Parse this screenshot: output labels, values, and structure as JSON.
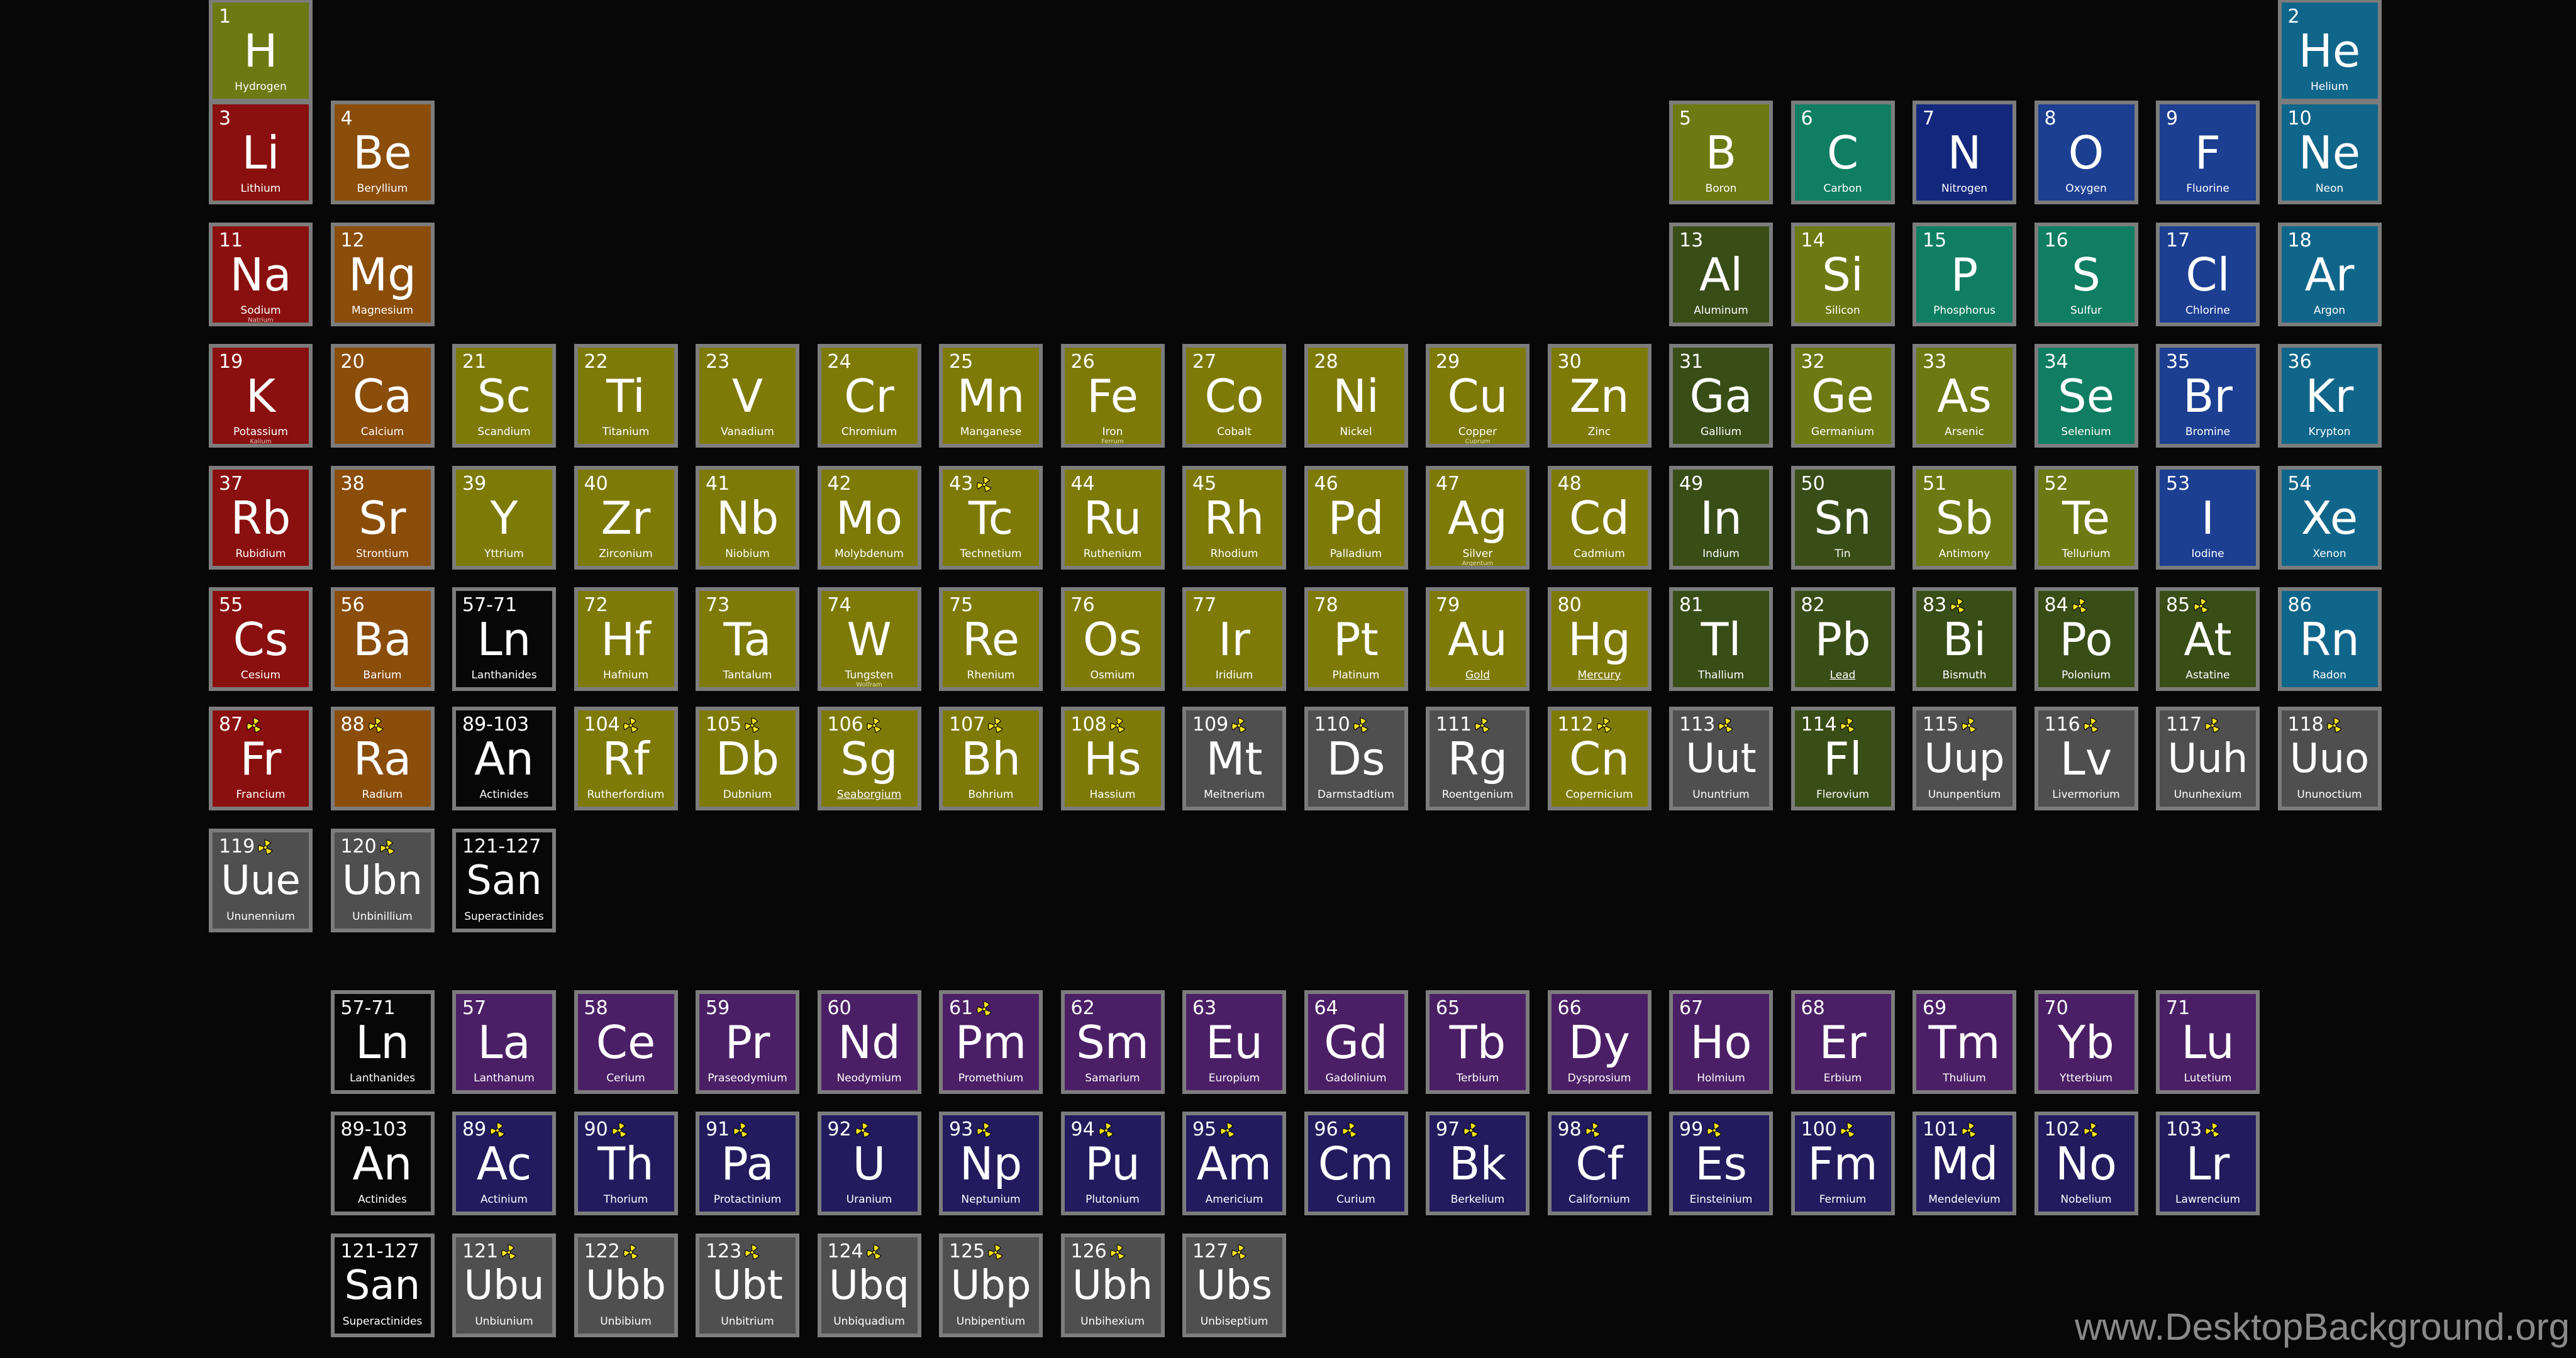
{
  "elements": [
    {
      "n": "1",
      "s": "H",
      "name": "Hydrogen",
      "c": "yg",
      "col": 1,
      "row": 1
    },
    {
      "n": "2",
      "s": "He",
      "name": "Helium",
      "c": "ng",
      "col": 18,
      "row": 1
    },
    {
      "n": "3",
      "s": "Li",
      "name": "Lithium",
      "c": "alk",
      "col": 1,
      "row": 2
    },
    {
      "n": "4",
      "s": "Be",
      "name": "Beryllium",
      "c": "ae",
      "col": 2,
      "row": 2
    },
    {
      "n": "5",
      "s": "B",
      "name": "Boron",
      "c": "yg",
      "col": 13,
      "row": 2
    },
    {
      "n": "6",
      "s": "C",
      "name": "Carbon",
      "c": "tl",
      "col": 14,
      "row": 2
    },
    {
      "n": "7",
      "s": "N",
      "name": "Nitrogen",
      "c": "nv",
      "col": 15,
      "row": 2
    },
    {
      "n": "8",
      "s": "O",
      "name": "Oxygen",
      "c": "bl",
      "col": 16,
      "row": 2
    },
    {
      "n": "9",
      "s": "F",
      "name": "Fluorine",
      "c": "bl",
      "col": 17,
      "row": 2
    },
    {
      "n": "10",
      "s": "Ne",
      "name": "Neon",
      "c": "ng",
      "col": 18,
      "row": 2
    },
    {
      "n": "11",
      "s": "Na",
      "name": "Sodium",
      "alt": "Natrium",
      "c": "alk",
      "col": 1,
      "row": 3
    },
    {
      "n": "12",
      "s": "Mg",
      "name": "Magnesium",
      "c": "ae",
      "col": 2,
      "row": 3
    },
    {
      "n": "13",
      "s": "Al",
      "name": "Aluminum",
      "c": "pt",
      "col": 13,
      "row": 3
    },
    {
      "n": "14",
      "s": "Si",
      "name": "Silicon",
      "c": "yg",
      "col": 14,
      "row": 3
    },
    {
      "n": "15",
      "s": "P",
      "name": "Phosphorus",
      "c": "tl",
      "col": 15,
      "row": 3
    },
    {
      "n": "16",
      "s": "S",
      "name": "Sulfur",
      "c": "tl",
      "col": 16,
      "row": 3
    },
    {
      "n": "17",
      "s": "Cl",
      "name": "Chlorine",
      "c": "bl",
      "col": 17,
      "row": 3
    },
    {
      "n": "18",
      "s": "Ar",
      "name": "Argon",
      "c": "ng",
      "col": 18,
      "row": 3
    },
    {
      "n": "19",
      "s": "K",
      "name": "Potassium",
      "alt": "Kalium",
      "c": "alk",
      "col": 1,
      "row": 4
    },
    {
      "n": "20",
      "s": "Ca",
      "name": "Calcium",
      "c": "ae",
      "col": 2,
      "row": 4
    },
    {
      "n": "21",
      "s": "Sc",
      "name": "Scandium",
      "c": "tm",
      "col": 3,
      "row": 4
    },
    {
      "n": "22",
      "s": "Ti",
      "name": "Titanium",
      "c": "tm",
      "col": 4,
      "row": 4
    },
    {
      "n": "23",
      "s": "V",
      "name": "Vanadium",
      "c": "tm",
      "col": 5,
      "row": 4
    },
    {
      "n": "24",
      "s": "Cr",
      "name": "Chromium",
      "c": "tm",
      "col": 6,
      "row": 4
    },
    {
      "n": "25",
      "s": "Mn",
      "name": "Manganese",
      "c": "tm",
      "col": 7,
      "row": 4
    },
    {
      "n": "26",
      "s": "Fe",
      "name": "Iron",
      "alt": "Ferrum",
      "c": "tm",
      "col": 8,
      "row": 4
    },
    {
      "n": "27",
      "s": "Co",
      "name": "Cobalt",
      "c": "tm",
      "col": 9,
      "row": 4
    },
    {
      "n": "28",
      "s": "Ni",
      "name": "Nickel",
      "c": "tm",
      "col": 10,
      "row": 4
    },
    {
      "n": "29",
      "s": "Cu",
      "name": "Copper",
      "alt": "Cuprum",
      "c": "tm",
      "col": 11,
      "row": 4
    },
    {
      "n": "30",
      "s": "Zn",
      "name": "Zinc",
      "c": "tm",
      "col": 12,
      "row": 4
    },
    {
      "n": "31",
      "s": "Ga",
      "name": "Gallium",
      "c": "pt",
      "col": 13,
      "row": 4
    },
    {
      "n": "32",
      "s": "Ge",
      "name": "Germanium",
      "c": "yg",
      "col": 14,
      "row": 4
    },
    {
      "n": "33",
      "s": "As",
      "name": "Arsenic",
      "c": "yg",
      "col": 15,
      "row": 4
    },
    {
      "n": "34",
      "s": "Se",
      "name": "Selenium",
      "c": "tl",
      "col": 16,
      "row": 4
    },
    {
      "n": "35",
      "s": "Br",
      "name": "Bromine",
      "c": "bl",
      "col": 17,
      "row": 4
    },
    {
      "n": "36",
      "s": "Kr",
      "name": "Krypton",
      "c": "ng",
      "col": 18,
      "row": 4
    },
    {
      "n": "37",
      "s": "Rb",
      "name": "Rubidium",
      "c": "alk",
      "col": 1,
      "row": 5
    },
    {
      "n": "38",
      "s": "Sr",
      "name": "Strontium",
      "c": "ae",
      "col": 2,
      "row": 5
    },
    {
      "n": "39",
      "s": "Y",
      "name": "Yttrium",
      "c": "tm",
      "col": 3,
      "row": 5
    },
    {
      "n": "40",
      "s": "Zr",
      "name": "Zirconium",
      "c": "tm",
      "col": 4,
      "row": 5
    },
    {
      "n": "41",
      "s": "Nb",
      "name": "Niobium",
      "c": "tm",
      "col": 5,
      "row": 5
    },
    {
      "n": "42",
      "s": "Mo",
      "name": "Molybdenum",
      "c": "tm",
      "col": 6,
      "row": 5
    },
    {
      "n": "43",
      "s": "Tc",
      "name": "Technetium",
      "c": "tm",
      "col": 7,
      "row": 5,
      "r": true
    },
    {
      "n": "44",
      "s": "Ru",
      "name": "Ruthenium",
      "c": "tm",
      "col": 8,
      "row": 5
    },
    {
      "n": "45",
      "s": "Rh",
      "name": "Rhodium",
      "c": "tm",
      "col": 9,
      "row": 5
    },
    {
      "n": "46",
      "s": "Pd",
      "name": "Palladium",
      "c": "tm",
      "col": 10,
      "row": 5
    },
    {
      "n": "47",
      "s": "Ag",
      "name": "Silver",
      "alt": "Argentum",
      "c": "tm",
      "col": 11,
      "row": 5
    },
    {
      "n": "48",
      "s": "Cd",
      "name": "Cadmium",
      "c": "tm",
      "col": 12,
      "row": 5
    },
    {
      "n": "49",
      "s": "In",
      "name": "Indium",
      "c": "pt",
      "col": 13,
      "row": 5
    },
    {
      "n": "50",
      "s": "Sn",
      "name": "Tin",
      "c": "pt",
      "col": 14,
      "row": 5
    },
    {
      "n": "51",
      "s": "Sb",
      "name": "Antimony",
      "c": "yg",
      "col": 15,
      "row": 5
    },
    {
      "n": "52",
      "s": "Te",
      "name": "Tellurium",
      "c": "yg",
      "col": 16,
      "row": 5
    },
    {
      "n": "53",
      "s": "I",
      "name": "Iodine",
      "c": "bl",
      "col": 17,
      "row": 5
    },
    {
      "n": "54",
      "s": "Xe",
      "name": "Xenon",
      "c": "ng",
      "col": 18,
      "row": 5
    },
    {
      "n": "55",
      "s": "Cs",
      "name": "Cesium",
      "c": "alk",
      "col": 1,
      "row": 6
    },
    {
      "n": "56",
      "s": "Ba",
      "name": "Barium",
      "c": "ae",
      "col": 2,
      "row": 6
    },
    {
      "n": "57-71",
      "s": "Ln",
      "name": "Lanthanides",
      "c": "blk",
      "col": 3,
      "row": 6
    },
    {
      "n": "72",
      "s": "Hf",
      "name": "Hafnium",
      "c": "tm",
      "col": 4,
      "row": 6
    },
    {
      "n": "73",
      "s": "Ta",
      "name": "Tantalum",
      "c": "tm",
      "col": 5,
      "row": 6
    },
    {
      "n": "74",
      "s": "W",
      "name": "Tungsten",
      "alt": "Wolfram",
      "c": "tm",
      "col": 6,
      "row": 6
    },
    {
      "n": "75",
      "s": "Re",
      "name": "Rhenium",
      "c": "tm",
      "col": 7,
      "row": 6
    },
    {
      "n": "76",
      "s": "Os",
      "name": "Osmium",
      "c": "tm",
      "col": 8,
      "row": 6
    },
    {
      "n": "77",
      "s": "Ir",
      "name": "Iridium",
      "c": "tm",
      "col": 9,
      "row": 6
    },
    {
      "n": "78",
      "s": "Pt",
      "name": "Platinum",
      "c": "tm",
      "col": 10,
      "row": 6
    },
    {
      "n": "79",
      "s": "Au",
      "name": "Gold",
      "c": "tm",
      "col": 11,
      "row": 6,
      "u": true
    },
    {
      "n": "80",
      "s": "Hg",
      "name": "Mercury",
      "c": "tm",
      "col": 12,
      "row": 6,
      "u": true
    },
    {
      "n": "81",
      "s": "Tl",
      "name": "Thallium",
      "c": "pt",
      "col": 13,
      "row": 6
    },
    {
      "n": "82",
      "s": "Pb",
      "name": "Lead",
      "c": "pt",
      "col": 14,
      "row": 6,
      "u": true
    },
    {
      "n": "83",
      "s": "Bi",
      "name": "Bismuth",
      "c": "pt",
      "col": 15,
      "row": 6,
      "r": true
    },
    {
      "n": "84",
      "s": "Po",
      "name": "Polonium",
      "c": "pt",
      "col": 16,
      "row": 6,
      "r": true
    },
    {
      "n": "85",
      "s": "At",
      "name": "Astatine",
      "c": "pt",
      "col": 17,
      "row": 6,
      "r": true
    },
    {
      "n": "86",
      "s": "Rn",
      "name": "Radon",
      "c": "ng",
      "col": 18,
      "row": 6
    },
    {
      "n": "87",
      "s": "Fr",
      "name": "Francium",
      "c": "alk",
      "col": 1,
      "row": 7,
      "r": true
    },
    {
      "n": "88",
      "s": "Ra",
      "name": "Radium",
      "c": "ae",
      "col": 2,
      "row": 7,
      "r": true
    },
    {
      "n": "89-103",
      "s": "An",
      "name": "Actinides",
      "c": "blk",
      "col": 3,
      "row": 7
    },
    {
      "n": "104",
      "s": "Rf",
      "name": "Rutherfordium",
      "c": "tm",
      "col": 4,
      "row": 7,
      "r": true
    },
    {
      "n": "105",
      "s": "Db",
      "name": "Dubnium",
      "c": "tm",
      "col": 5,
      "row": 7,
      "r": true
    },
    {
      "n": "106",
      "s": "Sg",
      "name": "Seaborgium",
      "c": "tm",
      "col": 6,
      "row": 7,
      "r": true,
      "u": true
    },
    {
      "n": "107",
      "s": "Bh",
      "name": "Bohrium",
      "c": "tm",
      "col": 7,
      "row": 7,
      "r": true
    },
    {
      "n": "108",
      "s": "Hs",
      "name": "Hassium",
      "c": "tm",
      "col": 8,
      "row": 7,
      "r": true
    },
    {
      "n": "109",
      "s": "Mt",
      "name": "Meitnerium",
      "c": "gr",
      "col": 9,
      "row": 7,
      "r": true
    },
    {
      "n": "110",
      "s": "Ds",
      "name": "Darmstadtium",
      "c": "gr",
      "col": 10,
      "row": 7,
      "r": true
    },
    {
      "n": "111",
      "s": "Rg",
      "name": "Roentgenium",
      "c": "gr",
      "col": 11,
      "row": 7,
      "r": true
    },
    {
      "n": "112",
      "s": "Cn",
      "name": "Copernicium",
      "c": "tm",
      "col": 12,
      "row": 7,
      "r": true
    },
    {
      "n": "113",
      "s": "Uut",
      "name": "Ununtrium",
      "c": "gr",
      "col": 13,
      "row": 7,
      "r": true
    },
    {
      "n": "114",
      "s": "Fl",
      "name": "Flerovium",
      "c": "pt",
      "col": 14,
      "row": 7,
      "r": true
    },
    {
      "n": "115",
      "s": "Uup",
      "name": "Ununpentium",
      "c": "gr",
      "col": 15,
      "row": 7,
      "r": true
    },
    {
      "n": "116",
      "s": "Lv",
      "name": "Livermorium",
      "c": "gr",
      "col": 16,
      "row": 7,
      "r": true
    },
    {
      "n": "117",
      "s": "Uuh",
      "name": "Ununhexium",
      "c": "gr",
      "col": 17,
      "row": 7,
      "r": true
    },
    {
      "n": "118",
      "s": "Uuo",
      "name": "Ununoctium",
      "c": "gr",
      "col": 18,
      "row": 7,
      "r": true
    },
    {
      "n": "119",
      "s": "Uue",
      "name": "Ununennium",
      "c": "gr",
      "col": 1,
      "row": 8,
      "r": true
    },
    {
      "n": "120",
      "s": "Ubn",
      "name": "Unbinillium",
      "c": "gr",
      "col": 2,
      "row": 8,
      "r": true
    },
    {
      "n": "121-127",
      "s": "San",
      "name": "Superactinides",
      "c": "blk",
      "col": 3,
      "row": 8
    },
    {
      "n": "57-71",
      "s": "Ln",
      "name": "Lanthanides",
      "c": "blk",
      "col": 2,
      "row": 9
    },
    {
      "n": "57",
      "s": "La",
      "name": "Lanthanum",
      "c": "la",
      "col": 3,
      "row": 9
    },
    {
      "n": "58",
      "s": "Ce",
      "name": "Cerium",
      "c": "la",
      "col": 4,
      "row": 9
    },
    {
      "n": "59",
      "s": "Pr",
      "name": "Praseodymium",
      "c": "la",
      "col": 5,
      "row": 9
    },
    {
      "n": "60",
      "s": "Nd",
      "name": "Neodymium",
      "c": "la",
      "col": 6,
      "row": 9
    },
    {
      "n": "61",
      "s": "Pm",
      "name": "Promethium",
      "c": "la",
      "col": 7,
      "row": 9,
      "r": true
    },
    {
      "n": "62",
      "s": "Sm",
      "name": "Samarium",
      "c": "la",
      "col": 8,
      "row": 9
    },
    {
      "n": "63",
      "s": "Eu",
      "name": "Europium",
      "c": "la",
      "col": 9,
      "row": 9
    },
    {
      "n": "64",
      "s": "Gd",
      "name": "Gadolinium",
      "c": "la",
      "col": 10,
      "row": 9
    },
    {
      "n": "65",
      "s": "Tb",
      "name": "Terbium",
      "c": "la",
      "col": 11,
      "row": 9
    },
    {
      "n": "66",
      "s": "Dy",
      "name": "Dysprosium",
      "c": "la",
      "col": 12,
      "row": 9
    },
    {
      "n": "67",
      "s": "Ho",
      "name": "Holmium",
      "c": "la",
      "col": 13,
      "row": 9
    },
    {
      "n": "68",
      "s": "Er",
      "name": "Erbium",
      "c": "la",
      "col": 14,
      "row": 9
    },
    {
      "n": "69",
      "s": "Tm",
      "name": "Thulium",
      "c": "la",
      "col": 15,
      "row": 9
    },
    {
      "n": "70",
      "s": "Yb",
      "name": "Ytterbium",
      "c": "la",
      "col": 16,
      "row": 9
    },
    {
      "n": "71",
      "s": "Lu",
      "name": "Lutetium",
      "c": "la",
      "col": 17,
      "row": 9
    },
    {
      "n": "89-103",
      "s": "An",
      "name": "Actinides",
      "c": "blk",
      "col": 2,
      "row": 10
    },
    {
      "n": "89",
      "s": "Ac",
      "name": "Actinium",
      "c": "ac",
      "col": 3,
      "row": 10,
      "r": true
    },
    {
      "n": "90",
      "s": "Th",
      "name": "Thorium",
      "c": "ac",
      "col": 4,
      "row": 10,
      "r": true
    },
    {
      "n": "91",
      "s": "Pa",
      "name": "Protactinium",
      "c": "ac",
      "col": 5,
      "row": 10,
      "r": true
    },
    {
      "n": "92",
      "s": "U",
      "name": "Uranium",
      "c": "ac",
      "col": 6,
      "row": 10,
      "r": true
    },
    {
      "n": "93",
      "s": "Np",
      "name": "Neptunium",
      "c": "ac",
      "col": 7,
      "row": 10,
      "r": true
    },
    {
      "n": "94",
      "s": "Pu",
      "name": "Plutonium",
      "c": "ac",
      "col": 8,
      "row": 10,
      "r": true
    },
    {
      "n": "95",
      "s": "Am",
      "name": "Americium",
      "c": "ac",
      "col": 9,
      "row": 10,
      "r": true
    },
    {
      "n": "96",
      "s": "Cm",
      "name": "Curium",
      "c": "ac",
      "col": 10,
      "row": 10,
      "r": true
    },
    {
      "n": "97",
      "s": "Bk",
      "name": "Berkelium",
      "c": "ac",
      "col": 11,
      "row": 10,
      "r": true
    },
    {
      "n": "98",
      "s": "Cf",
      "name": "Californium",
      "c": "ac",
      "col": 12,
      "row": 10,
      "r": true
    },
    {
      "n": "99",
      "s": "Es",
      "name": "Einsteinium",
      "c": "ac",
      "col": 13,
      "row": 10,
      "r": true
    },
    {
      "n": "100",
      "s": "Fm",
      "name": "Fermium",
      "c": "ac",
      "col": 14,
      "row": 10,
      "r": true
    },
    {
      "n": "101",
      "s": "Md",
      "name": "Mendelevium",
      "c": "ac",
      "col": 15,
      "row": 10,
      "r": true
    },
    {
      "n": "102",
      "s": "No",
      "name": "Nobelium",
      "c": "ac",
      "col": 16,
      "row": 10,
      "r": true
    },
    {
      "n": "103",
      "s": "Lr",
      "name": "Lawrencium",
      "c": "ac",
      "col": 17,
      "row": 10,
      "r": true
    },
    {
      "n": "121-127",
      "s": "San",
      "name": "Superactinides",
      "c": "blk",
      "col": 2,
      "row": 11
    },
    {
      "n": "121",
      "s": "Ubu",
      "name": "Unbiunium",
      "c": "gr",
      "col": 3,
      "row": 11,
      "r": true
    },
    {
      "n": "122",
      "s": "Ubb",
      "name": "Unbibium",
      "c": "gr",
      "col": 4,
      "row": 11,
      "r": true
    },
    {
      "n": "123",
      "s": "Ubt",
      "name": "Unbitrium",
      "c": "gr",
      "col": 5,
      "row": 11,
      "r": true
    },
    {
      "n": "124",
      "s": "Ubq",
      "name": "Unbiquadium",
      "c": "gr",
      "col": 6,
      "row": 11,
      "r": true
    },
    {
      "n": "125",
      "s": "Ubp",
      "name": "Unbipentium",
      "c": "gr",
      "col": 7,
      "row": 11,
      "r": true
    },
    {
      "n": "126",
      "s": "Ubh",
      "name": "Unbihexium",
      "c": "gr",
      "col": 8,
      "row": 11,
      "r": true
    },
    {
      "n": "127",
      "s": "Ubs",
      "name": "Unbiseptium",
      "c": "gr",
      "col": 9,
      "row": 11,
      "r": true
    }
  ],
  "colors": {
    "alk": "#8a0f0f",
    "ae": "#8a4d0a",
    "tm": "#7e7a08",
    "yg": "#6b7a12",
    "pt": "#394d17",
    "tl": "#0f7e63",
    "nv": "#13287d",
    "bl": "#1c3f92",
    "ng": "#10668a",
    "gr": "#4f4f4f",
    "blk": "#070707",
    "la": "#4b1f66",
    "ac": "#231b5e",
    "hazard": "#f2e21b"
  },
  "icon": "radioactive-icon",
  "watermark": "www.DesktopBackground.org"
}
